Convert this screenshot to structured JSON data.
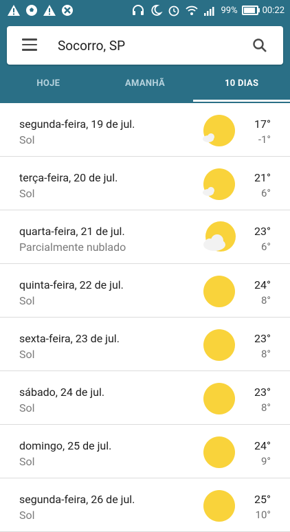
{
  "status_bar": {
    "battery_percent": "99%",
    "time": "00:22",
    "battery_fill_fraction": 0.99
  },
  "header": {
    "location": "Socorro, SP",
    "tabs": [
      "HOJE",
      "AMANHÃ",
      "10 DIAS"
    ],
    "active_tab": "10 DIAS",
    "colors": {
      "toolbar": "#2a6f86",
      "sun": "#f9d33b",
      "cloud": "#f2f2f2"
    }
  },
  "forecast": [
    {
      "day": "segunda-feira, 19 de jul.",
      "condition": "Sol",
      "high": "17°",
      "low": "-1°",
      "icon": "sun-with-small-cloud-icon"
    },
    {
      "day": "terça-feira, 20 de jul.",
      "condition": "Sol",
      "high": "21°",
      "low": "6°",
      "icon": "sun-with-small-cloud-icon"
    },
    {
      "day": "quarta-feira, 21 de jul.",
      "condition": "Parcialmente nublado",
      "high": "23°",
      "low": "6°",
      "icon": "partly-cloudy-icon"
    },
    {
      "day": "quinta-feira, 22 de jul.",
      "condition": "Sol",
      "high": "24°",
      "low": "8°",
      "icon": "sun-icon"
    },
    {
      "day": "sexta-feira, 23 de jul.",
      "condition": "Sol",
      "high": "23°",
      "low": "8°",
      "icon": "sun-icon"
    },
    {
      "day": "sábado, 24 de jul.",
      "condition": "Sol",
      "high": "23°",
      "low": "8°",
      "icon": "sun-icon"
    },
    {
      "day": "domingo, 25 de jul.",
      "condition": "Sol",
      "high": "24°",
      "low": "9°",
      "icon": "sun-icon"
    },
    {
      "day": "segunda-feira, 26 de jul.",
      "condition": "Sol",
      "high": "25°",
      "low": "10°",
      "icon": "sun-icon"
    }
  ]
}
